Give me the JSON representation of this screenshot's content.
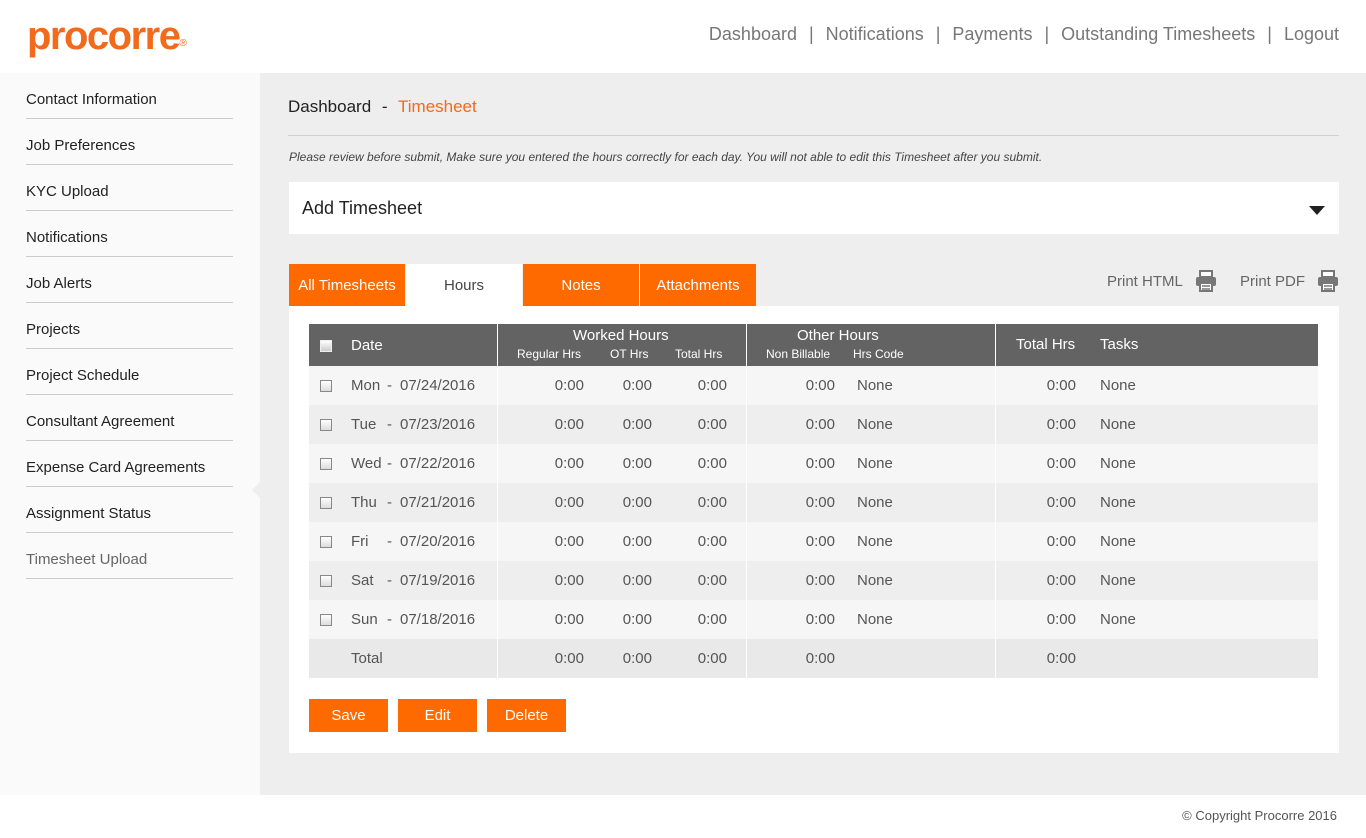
{
  "header": {
    "logo_text": "procorre",
    "logo_mark": "®",
    "nav": [
      "Dashboard",
      "Notifications",
      "Payments",
      "Outstanding Timesheets",
      "Logout"
    ],
    "nav_separator": "|"
  },
  "sidebar": {
    "items": [
      "Contact Information",
      "Job Preferences",
      "KYC Upload",
      "Notifications",
      "Job Alerts",
      "Projects",
      "Project Schedule",
      "Consultant Agreement",
      "Expense Card Agreements",
      "Assignment Status",
      "Timesheet Upload"
    ],
    "active_item": "Timesheet Upload"
  },
  "breadcrumb": {
    "root": "Dashboard",
    "separator": "-",
    "current": "Timesheet"
  },
  "notice": "Please review before submit, Make sure you entered the hours correctly for each day. You will not able to edit this Timesheet after you submit.",
  "add_timesheet": {
    "label": "Add Timesheet",
    "icon": "caret-down-icon"
  },
  "tabs": [
    {
      "label": "All Timesheets",
      "active": false
    },
    {
      "label": "Hours",
      "active": true
    },
    {
      "label": "Notes",
      "active": false
    },
    {
      "label": "Attachments",
      "active": false
    }
  ],
  "print": {
    "html_label": "Print HTML",
    "pdf_label": "Print PDF",
    "icon": "printer-icon"
  },
  "table": {
    "headers": {
      "date": "Date",
      "worked_hours": "Worked Hours",
      "regular_hrs": "Regular Hrs",
      "ot_hrs": "OT Hrs",
      "total_hrs_sub": "Total Hrs",
      "other_hours": "Other Hours",
      "non_billable": "Non Billable",
      "hrs_code": "Hrs Code",
      "total_hrs": "Total Hrs",
      "tasks": "Tasks"
    },
    "rows": [
      {
        "day": "Mon",
        "sep": "-",
        "date": "07/24/2016",
        "regular": "0:00",
        "ot": "0:00",
        "worked_total": "0:00",
        "non_billable": "0:00",
        "hrs_code": "None",
        "total": "0:00",
        "tasks": "None"
      },
      {
        "day": "Tue",
        "sep": "-",
        "date": "07/23/2016",
        "regular": "0:00",
        "ot": "0:00",
        "worked_total": "0:00",
        "non_billable": "0:00",
        "hrs_code": "None",
        "total": "0:00",
        "tasks": "None"
      },
      {
        "day": "Wed",
        "sep": "-",
        "date": "07/22/2016",
        "regular": "0:00",
        "ot": "0:00",
        "worked_total": "0:00",
        "non_billable": "0:00",
        "hrs_code": "None",
        "total": "0:00",
        "tasks": "None"
      },
      {
        "day": "Thu",
        "sep": "-",
        "date": "07/21/2016",
        "regular": "0:00",
        "ot": "0:00",
        "worked_total": "0:00",
        "non_billable": "0:00",
        "hrs_code": "None",
        "total": "0:00",
        "tasks": "None"
      },
      {
        "day": "Fri",
        "sep": "-",
        "date": "07/20/2016",
        "regular": "0:00",
        "ot": "0:00",
        "worked_total": "0:00",
        "non_billable": "0:00",
        "hrs_code": "None",
        "total": "0:00",
        "tasks": "None"
      },
      {
        "day": "Sat",
        "sep": "-",
        "date": "07/19/2016",
        "regular": "0:00",
        "ot": "0:00",
        "worked_total": "0:00",
        "non_billable": "0:00",
        "hrs_code": "None",
        "total": "0:00",
        "tasks": "None"
      },
      {
        "day": "Sun",
        "sep": "-",
        "date": "07/18/2016",
        "regular": "0:00",
        "ot": "0:00",
        "worked_total": "0:00",
        "non_billable": "0:00",
        "hrs_code": "None",
        "total": "0:00",
        "tasks": "None"
      }
    ],
    "total_row": {
      "label": "Total",
      "regular": "0:00",
      "ot": "0:00",
      "worked_total": "0:00",
      "non_billable": "0:00",
      "total": "0:00"
    }
  },
  "buttons": {
    "save": "Save",
    "edit": "Edit",
    "delete": "Delete"
  },
  "footer": {
    "copyright": "© Copyright Procorre 2016"
  },
  "colors": {
    "accent": "#ff6a00",
    "logo": "#f26a1b",
    "table_header": "#636363",
    "page_bg": "#eeeeee"
  }
}
